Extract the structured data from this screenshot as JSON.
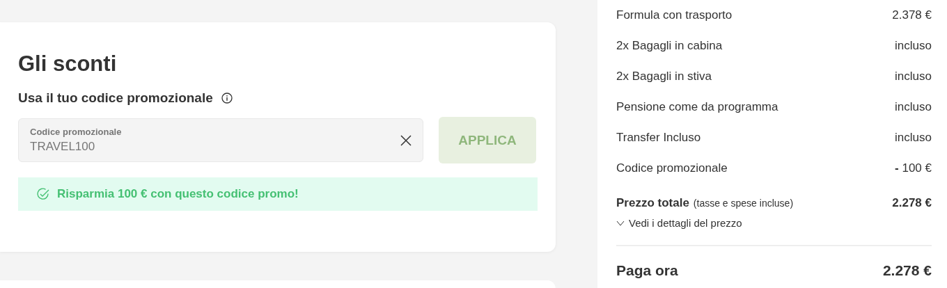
{
  "discounts": {
    "title": "Gli sconti",
    "subtitle": "Usa il tuo codice promozionale",
    "field": {
      "label": "Codice promozionale",
      "value": "TRAVEL100"
    },
    "apply_button": {
      "label": "APPLICA",
      "disabled": true
    },
    "message": {
      "kind": "success",
      "text": "Risparmia 100 € con questo codice promo!"
    }
  },
  "summary": {
    "items": [
      {
        "label": "Formula con trasporto",
        "value": "2.378 €"
      },
      {
        "label": "2x Bagagli in cabina",
        "value": "incluso"
      },
      {
        "label": "2x Bagagli in stiva",
        "value": "incluso"
      },
      {
        "label": "Pensione come da programma",
        "value": "incluso"
      },
      {
        "label": "Transfer Incluso",
        "value": "incluso"
      },
      {
        "label": "Codice promozionale",
        "value": "**-** 100 €"
      }
    ],
    "total": {
      "label": "Prezzo totale",
      "note": "(tasse e spese incluse)",
      "value": "2.278 €"
    },
    "details_link": {
      "label": "Vedi i dettagli del prezzo",
      "expanded": false
    },
    "pay_now": {
      "label": "Paga ora",
      "value": "2.278 €"
    }
  }
}
